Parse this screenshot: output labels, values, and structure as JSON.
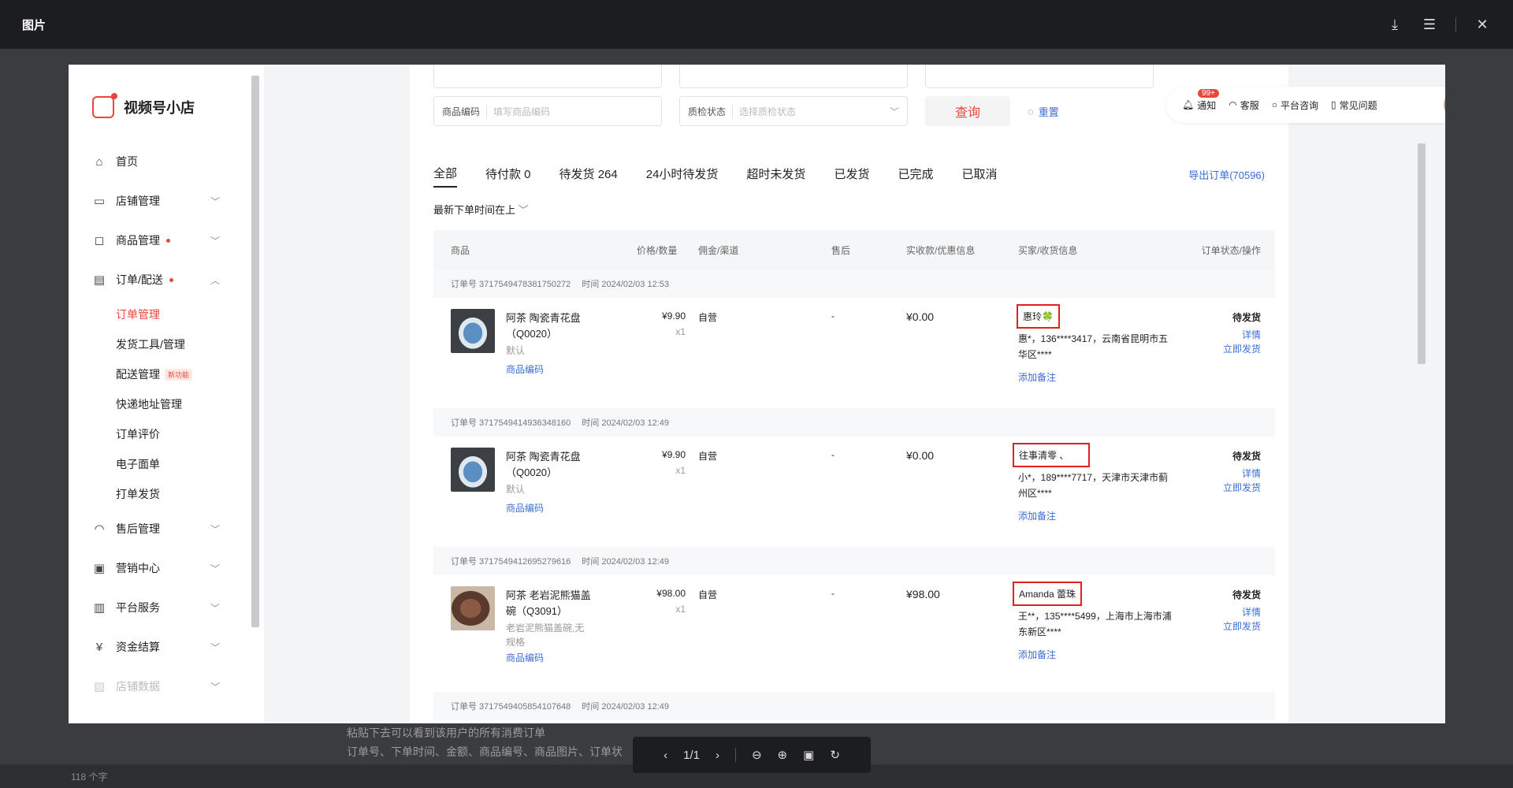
{
  "viewer": {
    "title": "图片",
    "page_indicator": "1/1"
  },
  "background": {
    "caption_line1": "粘贴下去可以看到该用户的所有消费订单",
    "caption_line2": "订单号、下单时间、金额、商品编号、商品图片、订单状",
    "status_text": "118 个字"
  },
  "app": {
    "name": "视频号小店"
  },
  "sidebar": {
    "items": [
      {
        "label": "首页",
        "icon": "home-icon"
      },
      {
        "label": "店铺管理",
        "icon": "store-icon"
      },
      {
        "label": "商品管理",
        "icon": "bag-icon"
      },
      {
        "label": "订单/配送",
        "icon": "clipboard-icon"
      }
    ],
    "sub_items": [
      "订单管理",
      "发货工具/管理",
      "配送管理",
      "快递地址管理",
      "订单评价",
      "电子面单",
      "打单发货"
    ],
    "new_badge": "新功能",
    "items2": [
      {
        "label": "售后管理",
        "icon": "headset-icon"
      },
      {
        "label": "营销中心",
        "icon": "coupon-icon"
      },
      {
        "label": "平台服务",
        "icon": "briefcase-icon"
      },
      {
        "label": "资金结算",
        "icon": "yen-icon"
      },
      {
        "label": "店铺数据",
        "icon": "chart-icon"
      }
    ]
  },
  "filters": {
    "goods_code_label": "商品编码",
    "goods_code_placeholder": "填写商品编码",
    "quality_label": "质检状态",
    "quality_placeholder": "选择质检状态",
    "query": "查询",
    "reset": "重置"
  },
  "tools": {
    "notify": "通知",
    "badge": "99+",
    "service": "客服",
    "consult": "平台咨询",
    "faq": "常见问题"
  },
  "tabs": [
    "全部",
    "待付款 0",
    "待发货 264",
    "24小时待发货",
    "超时未发货",
    "已发货",
    "已完成",
    "已取消"
  ],
  "export": "导出订单(70596)",
  "sort": "最新下单时间在上",
  "columns": [
    "商品",
    "价格/数量",
    "佣金/渠道",
    "售后",
    "实收款/优惠信息",
    "买家/收货信息",
    "订单状态/操作"
  ],
  "orders": [
    {
      "order_no": "订单号 3717549478381750272",
      "time": "时间 2024/02/03 12:53",
      "name": "阿茶 陶瓷青花盘（Q0020）",
      "spec": "默认",
      "code": "商品编码",
      "price": "¥9.90",
      "qty": "x1",
      "channel": "自营",
      "aftersale": "-",
      "paid": "¥0.00",
      "buyer": "惠玲🍀",
      "addr": "惠*，136****3417，云南省昆明市五华区****",
      "note": "添加备注",
      "status": "待发货",
      "op1": "详情",
      "op2": "立即发货"
    },
    {
      "order_no": "订单号 3717549414936348160",
      "time": "时间 2024/02/03 12:49",
      "name": "阿茶 陶瓷青花盘（Q0020）",
      "spec": "默认",
      "code": "商品编码",
      "price": "¥9.90",
      "qty": "x1",
      "channel": "自营",
      "aftersale": "-",
      "paid": "¥0.00",
      "buyer": "往事清零 、",
      "addr": "小*，189****7717，天津市天津市蓟州区****",
      "note": "添加备注",
      "status": "待发货",
      "op1": "详情",
      "op2": "立即发货"
    },
    {
      "order_no": "订单号 3717549412695279616",
      "time": "时间 2024/02/03 12:49",
      "name": "阿茶 老岩泥熊猫盖碗（Q3091）",
      "spec": "老岩泥熊猫盖碗,无规格",
      "code": "商品编码",
      "price": "¥98.00",
      "qty": "x1",
      "channel": "自营",
      "aftersale": "-",
      "paid": "¥98.00",
      "buyer": "Amanda 蕾珠",
      "addr": "王**，135****5499，上海市上海市浦东新区****",
      "note": "添加备注",
      "status": "待发货",
      "op1": "详情",
      "op2": "立即发货"
    },
    {
      "order_no": "订单号 3717549405854107648",
      "time": "时间 2024/02/03 12:49"
    }
  ]
}
